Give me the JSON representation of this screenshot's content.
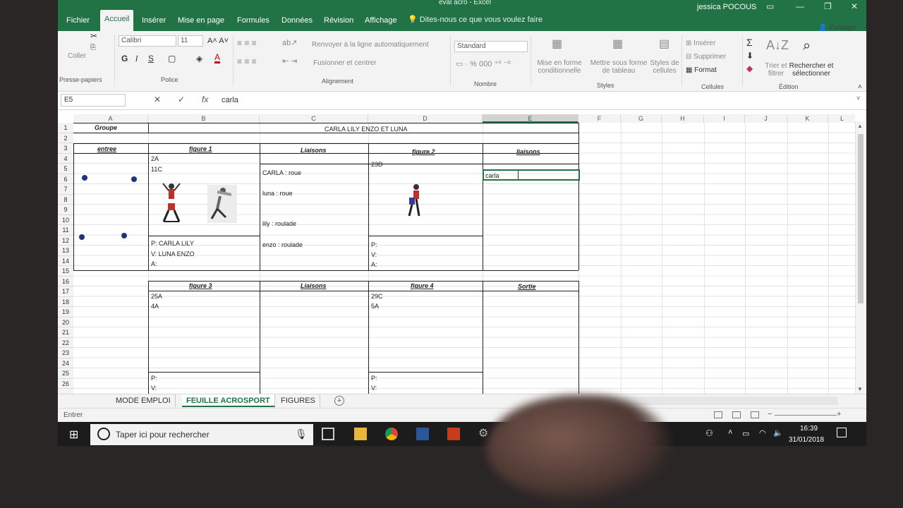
{
  "window": {
    "doc_title": "eval acro  -  Excel",
    "user": "jessica POCOUS"
  },
  "tabs": [
    "Fichier",
    "Accueil",
    "Insérer",
    "Mise en page",
    "Formules",
    "Données",
    "Révision",
    "Affichage"
  ],
  "tell_me": "Dites-nous ce que vous voulez faire",
  "share": "Partager",
  "ribbon": {
    "clipboard": {
      "paste": "Coller",
      "label": "Presse-papiers"
    },
    "font": {
      "family": "Calibri",
      "size": "11",
      "label": "Police",
      "bold": "G",
      "italic": "I",
      "underline": "S"
    },
    "alignment": {
      "wrap": "Renvoyer à la ligne automatiquement",
      "merge": "Fusionner et centrer",
      "label": "Alignement"
    },
    "number": {
      "format": "Standard",
      "label": "Nombre"
    },
    "styles": {
      "conditional": "Mise en forme conditionnelle",
      "table": "Mettre sous forme de tableau",
      "cell_styles": "Styles de cellules",
      "label": "Styles"
    },
    "cells": {
      "insert": "Insérer",
      "delete": "Supprimer",
      "format": "Format",
      "label": "Cellules"
    },
    "editing": {
      "sort": "Trier et filtrer",
      "find": "Rechercher et sélectionner",
      "label": "Édition"
    }
  },
  "formula_bar": {
    "name_box": "E5",
    "value": "carla"
  },
  "columns": [
    "A",
    "B",
    "C",
    "D",
    "E",
    "F",
    "G",
    "H",
    "I",
    "J",
    "K",
    "L"
  ],
  "rows": [
    "1",
    "2",
    "3",
    "4",
    "5",
    "6",
    "7",
    "8",
    "9",
    "10",
    "11",
    "12",
    "13",
    "14",
    "15",
    "16",
    "17",
    "18",
    "19",
    "20",
    "21",
    "22",
    "23",
    "24",
    "25",
    "26"
  ],
  "sheet": {
    "groupe_label": "Groupe",
    "groupe_value": "CARLA LILY ENZO ET LUNA",
    "entree": "entree",
    "figure1": "figure 1",
    "liaisons1": "Liaisons",
    "figure2": "figure 2",
    "liaisons2": "liaisons",
    "f1_code1": "2A",
    "f1_code2": "11C",
    "f1_p": "P: CARLA LILY",
    "f1_v": "V: LUNA ENZO",
    "f1_a": "A:",
    "l1_a": "CARLA : roue",
    "l1_b": "luna : roue",
    "l1_c": "lily : roulade",
    "l1_d": "enzo : roulade",
    "f2_code": "23D",
    "f2_p": "P:",
    "f2_v": "V:",
    "f2_a": "A:",
    "edit_cell": "carla",
    "figure3": "figure 3",
    "liaisons3": "Liaisons",
    "figure4": "figure 4",
    "sortie": "Sortie",
    "f3_code1": "25A",
    "f3_code2": "4A",
    "f3_p": "P:",
    "f3_v": "V:",
    "f4_code1": "29C",
    "f4_code2": "5A",
    "f4_p": "P:",
    "f4_v": "V:"
  },
  "sheet_tabs": [
    "MODE EMPLOI",
    "FEUILLE ACROSPORT",
    "FIGURES"
  ],
  "status": "Entrer",
  "taskbar": {
    "search": "Taper ici pour rechercher",
    "time": "16:39",
    "date": "31/01/2018"
  },
  "colors": {
    "excel_green": "#217346",
    "taskbar": "#1c1c1c",
    "dot": "#23307a"
  }
}
